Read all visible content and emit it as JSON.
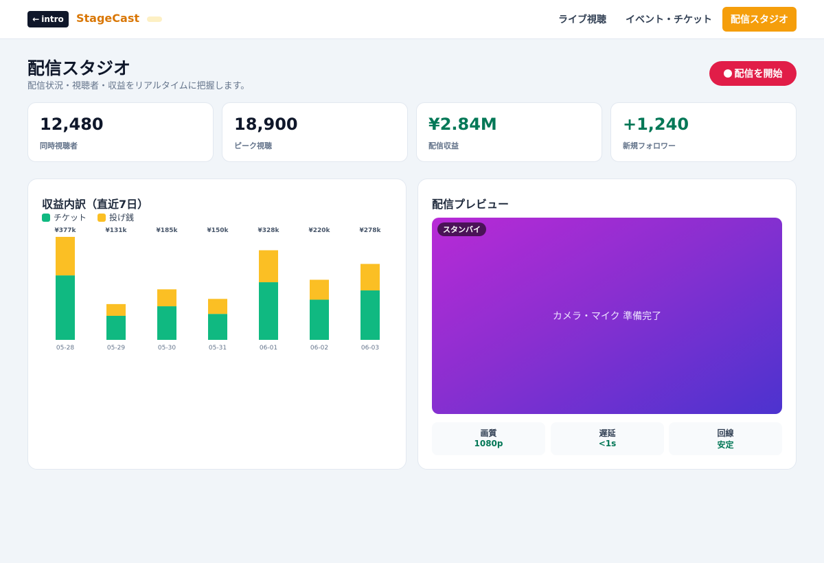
{
  "header": {
    "back_label": "intro",
    "brand": "StageCast",
    "nav": [
      "ライブ視聴",
      "イベント・チケット"
    ],
    "active_nav": "配信スタジオ"
  },
  "page": {
    "title": "配信スタジオ",
    "subtitle": "配信状況・視聴者・収益をリアルタイムに把握します。",
    "start_button": "配信を開始"
  },
  "stats": [
    {
      "value": "12,480",
      "label": "同時視聴者"
    },
    {
      "value": "18,900",
      "label": "ピーク視聴"
    },
    {
      "value": "¥2.84M",
      "label": "配信収益"
    },
    {
      "value": "+1,240",
      "label": "新規フォロワー"
    }
  ],
  "colors": {
    "ticket": "#10b981",
    "tip": "#fbbf24",
    "accent": "#f59e0b",
    "live": "#e11d48"
  },
  "chart_data": {
    "type": "bar",
    "stacked": true,
    "title": "収益内訳（直近7日）",
    "categories": [
      "05-28",
      "05-29",
      "05-30",
      "05-31",
      "06-01",
      "06-02",
      "06-03"
    ],
    "totals_labels": [
      "¥377k",
      "¥131k",
      "¥185k",
      "¥150k",
      "¥328k",
      "¥220k",
      "¥278k"
    ],
    "series": [
      {
        "name": "チケット",
        "values": [
          236,
          88,
          123,
          95,
          211,
          147,
          181
        ]
      },
      {
        "name": "投げ銭",
        "values": [
          141,
          43,
          62,
          55,
          117,
          73,
          97
        ]
      }
    ],
    "ylim": [
      0,
      377
    ],
    "grid": false,
    "legend": "top-left"
  },
  "preview": {
    "title": "配信プレビュー",
    "badge": "スタンバイ",
    "message": "カメラ・マイク 準備完了",
    "info": [
      {
        "label": "画質",
        "value": "1080p"
      },
      {
        "label": "遅延",
        "value": "<1s"
      },
      {
        "label": "回線",
        "value": "安定"
      }
    ]
  }
}
